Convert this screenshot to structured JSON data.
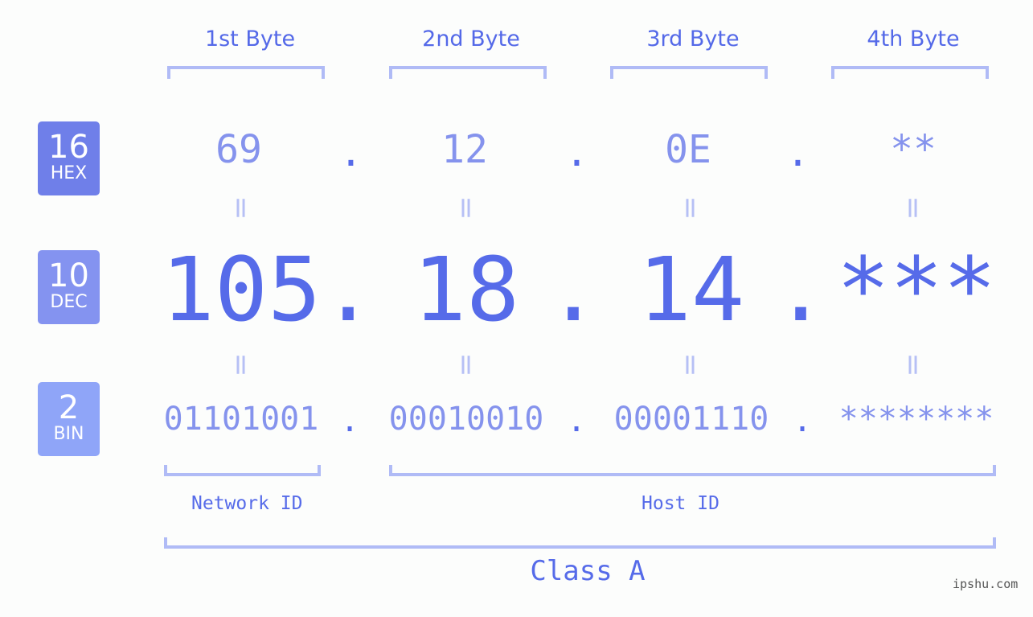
{
  "badges": [
    {
      "number": "16",
      "label": "HEX",
      "color": "#6f7fe9"
    },
    {
      "number": "10",
      "label": "DEC",
      "color": "#8493f0"
    },
    {
      "number": "2",
      "label": "BIN",
      "color": "#8fa5f8"
    }
  ],
  "byte_headers": [
    "1st Byte",
    "2nd Byte",
    "3rd Byte",
    "4th Byte"
  ],
  "separator": ".",
  "equals_sign": "=",
  "hex": [
    "69",
    "12",
    "0E",
    "**"
  ],
  "dec": [
    "105",
    "18",
    "14",
    "***"
  ],
  "bin": [
    "01101001",
    "00010010",
    "00001110",
    "********"
  ],
  "network_id_label": "Network ID",
  "host_id_label": "Host ID",
  "class_label": "Class A",
  "watermark": "ipshu.com"
}
